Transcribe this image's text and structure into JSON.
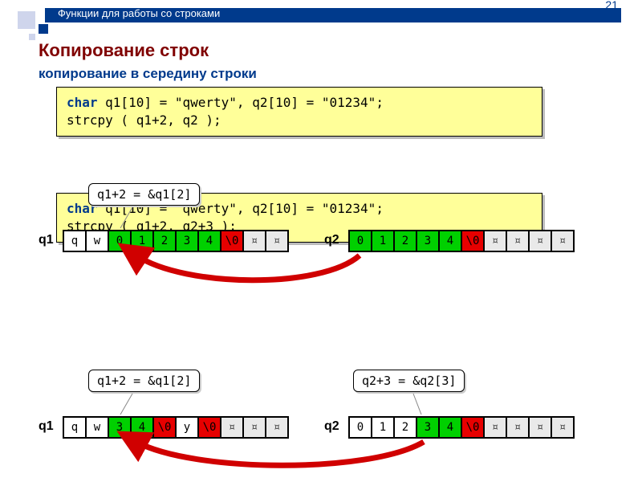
{
  "header": {
    "title": "Функции для работы со строками",
    "page": "21"
  },
  "h1": "Копирование строк",
  "h2": "копирование в середину строки",
  "code1": {
    "l1a": "char",
    "l1b": " q1[10] = \"qwerty\", q2[10] = \"01234\";",
    "l2": "strcpy ( q1+2, q2 );"
  },
  "callout1": "q1+2 = &q1[2]",
  "ex1": {
    "q1label": "q1",
    "q2label": "q2",
    "q1": [
      "q",
      "w",
      "0",
      "1",
      "2",
      "3",
      "4",
      "\\0",
      "¤",
      "¤"
    ],
    "q2": [
      "0",
      "1",
      "2",
      "3",
      "4",
      "\\0",
      "¤",
      "¤",
      "¤",
      "¤"
    ]
  },
  "code2": {
    "l1a": "char",
    "l1b": " q1[10] = \"qwerty\", q2[10] = \"01234\";",
    "l2": "strcpy ( q1+2, q2+3 );"
  },
  "callout2a": "q1+2 = &q1[2]",
  "callout2b": "q2+3 = &q2[3]",
  "ex2": {
    "q1label": "q1",
    "q2label": "q2",
    "q1": [
      "q",
      "w",
      "3",
      "4",
      "\\0",
      "y",
      "\\0",
      "¤",
      "¤",
      "¤"
    ],
    "q2": [
      "0",
      "1",
      "2",
      "3",
      "4",
      "\\0",
      "¤",
      "¤",
      "¤",
      "¤"
    ]
  }
}
